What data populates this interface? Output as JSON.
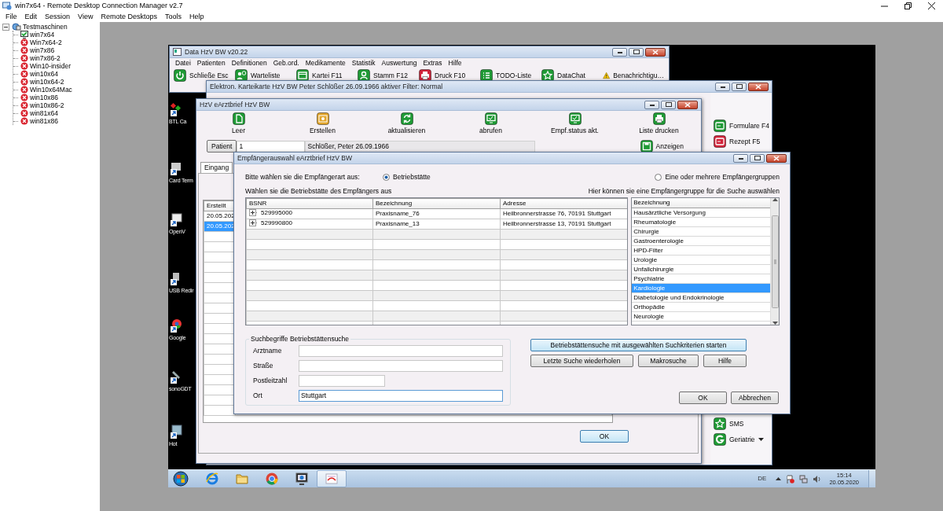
{
  "window": {
    "title": "win7x64 - Remote Desktop Connection Manager v2.7"
  },
  "menu": [
    "File",
    "Edit",
    "Session",
    "View",
    "Remote Desktops",
    "Tools",
    "Help"
  ],
  "tree": {
    "label": "Testmaschinen",
    "expanded": true,
    "children": [
      {
        "label": "win7x64",
        "connected": true
      },
      {
        "label": "Win7x64-2",
        "connected": false
      },
      {
        "label": "win7x86",
        "connected": false
      },
      {
        "label": "win7x86-2",
        "connected": false
      },
      {
        "label": "Win10-insider",
        "connected": false
      },
      {
        "label": "win10x64",
        "connected": false
      },
      {
        "label": "win10x64-2",
        "connected": false
      },
      {
        "label": "Win10x64Mac",
        "connected": false
      },
      {
        "label": "win10x86",
        "connected": false
      },
      {
        "label": "win10x86-2",
        "connected": false
      },
      {
        "label": "win81x64",
        "connected": false
      },
      {
        "label": "win81x86",
        "connected": false
      }
    ]
  },
  "desktop_icons": [
    "BTL Ca",
    "Card Term",
    "OpenV",
    "USB Redir",
    "Google",
    "sonoGDT",
    "Hot"
  ],
  "data_window": {
    "title": "Data HzV BW v20.22",
    "menu": [
      "Datei",
      "Patienten",
      "Definitionen",
      "Geb.ord.",
      "Medikamente",
      "Statistik",
      "Auswertung",
      "Extras",
      "Hilfe"
    ],
    "toolbar": [
      "Schließe Esc",
      "Warteliste",
      "Kartei F11",
      "Stamm F12",
      "Druck F10",
      "TODO-Liste",
      "DataChat",
      "Benachrichtigu…"
    ]
  },
  "record_window": {
    "title": "Elektron. Karteikarte HzV BW Peter Schlößer 26.09.1966 aktiver Filter: Normal",
    "side_buttons": [
      "Formulare F4",
      "Rezept F5"
    ],
    "side_buttons_bottom": [
      "SMS",
      "Geriatrie"
    ]
  },
  "letter_window": {
    "title": "HzV eArztbrief HzV BW",
    "toolbar": [
      "Leer",
      "Erstellen",
      "aktualisieren",
      "abrufen",
      "Empf.status akt.",
      "Liste drucken"
    ],
    "patient_button": "Patient",
    "patient_id": "1",
    "patient_name": "Schlößer, Peter 26.09.1966",
    "show_button": "Anzeigen",
    "tabs": [
      {
        "label": "Eingang",
        "selected": true
      }
    ],
    "list": {
      "columns": [
        "Erstellt"
      ],
      "rows": [
        {
          "cells": [
            "20.05.202"
          ],
          "selected": false
        },
        {
          "cells": [
            "20.05.202"
          ],
          "selected": true
        }
      ]
    },
    "ok_button": "OK"
  },
  "dialog": {
    "title": "Empfängerauswahl eArztbrief HzV BW",
    "prompt": "Bitte wählen sie die Empfängerart aus:",
    "recipient_types": [
      {
        "label": "Betriebstätte",
        "selected": true
      },
      {
        "label": "Eine oder mehrere Empfängergruppen",
        "selected": false
      }
    ],
    "practice_caption": "Wählen sie die Betriebstätte des Empfängers aus",
    "group_caption": "Hier können sie eine Empfängergruppe für die Suche auswählen",
    "practices": {
      "columns": [
        "BSNR",
        "Bezeichnung",
        "Adresse"
      ],
      "rows": [
        {
          "cells": [
            "529995000",
            "Praxisname_76",
            "Heilbronnerstrasse 76, 70191 Stuttgart"
          ]
        },
        {
          "cells": [
            "529990800",
            "Praxisname_13",
            "Heilbronnerstrasse 13, 70191 Stuttgart"
          ]
        }
      ]
    },
    "groups": {
      "column": "Bezeichnung",
      "items": [
        {
          "label": "Hausärztliche Versorgung",
          "selected": false
        },
        {
          "label": "Rheumatologie",
          "selected": false
        },
        {
          "label": "Chirurgie",
          "selected": false
        },
        {
          "label": "Gastroenterologie",
          "selected": false
        },
        {
          "label": "HPD-Filter",
          "selected": false
        },
        {
          "label": "Urologie",
          "selected": false
        },
        {
          "label": "Unfallchirurgie",
          "selected": false
        },
        {
          "label": "Psychiatrie",
          "selected": false
        },
        {
          "label": "Kardiologie",
          "selected": true
        },
        {
          "label": "Diabetologie und Endokrinologie",
          "selected": false
        },
        {
          "label": "Orthopädie",
          "selected": false
        },
        {
          "label": "Neurologie",
          "selected": false
        }
      ]
    },
    "search": {
      "title": "Suchbegriffe Betriebstättensuche",
      "fields": [
        {
          "label": "Arztname",
          "kind": "wide"
        },
        {
          "label": "Straße",
          "kind": "wide"
        },
        {
          "label": "Postleitzahl",
          "kind": "short"
        },
        {
          "label": "Ort",
          "kind": "wide",
          "value": "Stuttgart"
        }
      ]
    },
    "search_button": "Betriebstättensuche mit ausgewählten Suchkriterien starten",
    "buttons": [
      "Letzte Suche wiederholen",
      "Makrosuche",
      "Hilfe"
    ],
    "ok_button": "OK",
    "cancel_button": "Abbrechen"
  },
  "taskbar": {
    "language": "DE",
    "time": "15:14",
    "date": "20.05.2020"
  }
}
